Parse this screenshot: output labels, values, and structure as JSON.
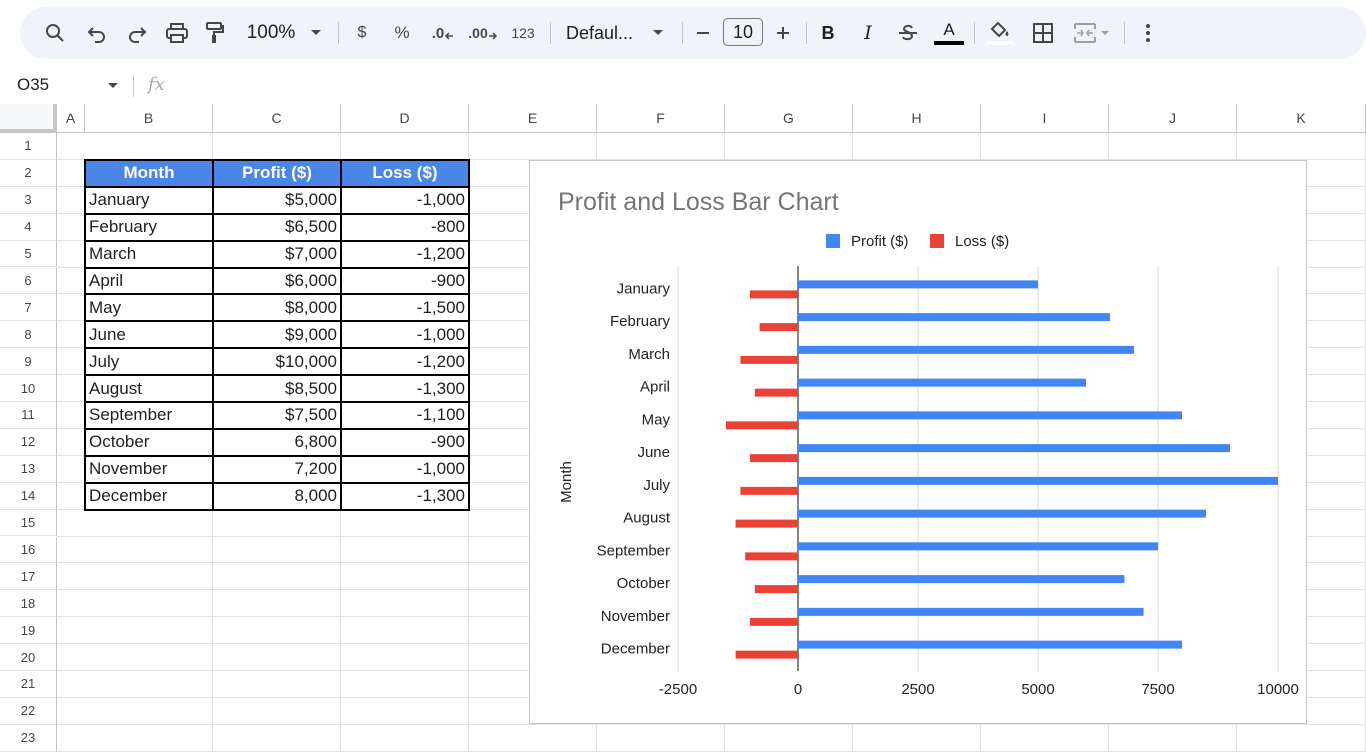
{
  "toolbar": {
    "zoom": "100%",
    "currency_label": "$",
    "percent_label": "%",
    "decrease_decimal_label": ".0",
    "increase_decimal_label": ".00",
    "more_formats_label": "123",
    "font_name": "Defaul...",
    "font_size": "10",
    "bold_label": "B",
    "italic_label": "I",
    "text_color_label": "A",
    "icons": [
      "search-icon",
      "undo-icon",
      "redo-icon",
      "print-icon",
      "paint-format-icon",
      "zoom-dropdown-icon",
      "font-dropdown-icon",
      "minus-icon",
      "plus-icon",
      "strikethrough-icon",
      "fill-color-icon",
      "borders-icon",
      "merge-cells-icon",
      "more-vert-icon"
    ]
  },
  "formula_bar": {
    "name_box": "O35",
    "fx_label": "fx"
  },
  "columns": [
    "A",
    "B",
    "C",
    "D",
    "E",
    "F",
    "G",
    "H",
    "I",
    "J",
    "K"
  ],
  "rows": [
    "1",
    "2",
    "3",
    "4",
    "5",
    "6",
    "7",
    "8",
    "9",
    "10",
    "11",
    "12",
    "13",
    "14",
    "15",
    "16",
    "17",
    "18",
    "19",
    "20",
    "21",
    "22",
    "23"
  ],
  "table": {
    "headers": [
      "Month",
      "Profit ($)",
      "Loss ($)"
    ],
    "header_color": "#4a86e8",
    "rows": [
      [
        "January",
        "$5,000",
        "-1,000"
      ],
      [
        "February",
        "$6,500",
        "-800"
      ],
      [
        "March",
        "$7,000",
        "-1,200"
      ],
      [
        "April",
        "$6,000",
        "-900"
      ],
      [
        "May",
        "$8,000",
        "-1,500"
      ],
      [
        "June",
        "$9,000",
        "-1,000"
      ],
      [
        "July",
        "$10,000",
        "-1,200"
      ],
      [
        "August",
        "$8,500",
        "-1,300"
      ],
      [
        "September",
        "$7,500",
        "-1,100"
      ],
      [
        "October",
        "6,800",
        "-900"
      ],
      [
        "November",
        "7,200",
        "-1,000"
      ],
      [
        "December",
        "8,000",
        "-1,300"
      ]
    ]
  },
  "chart_data": {
    "type": "bar",
    "orientation": "horizontal",
    "title": "Profit and Loss Bar Chart",
    "xlabel": "",
    "ylabel": "Month",
    "categories": [
      "January",
      "February",
      "March",
      "April",
      "May",
      "June",
      "July",
      "August",
      "September",
      "October",
      "November",
      "December"
    ],
    "series": [
      {
        "name": "Profit ($)",
        "color": "#4285f4",
        "values": [
          5000,
          6500,
          7000,
          6000,
          8000,
          9000,
          10000,
          8500,
          7500,
          6800,
          7200,
          8000
        ]
      },
      {
        "name": "Loss ($)",
        "color": "#ea4335",
        "values": [
          -1000,
          -800,
          -1200,
          -900,
          -1500,
          -1000,
          -1200,
          -1300,
          -1100,
          -900,
          -1000,
          -1300
        ]
      }
    ],
    "xlim": [
      -2500,
      10000
    ],
    "xticks": [
      "-2500",
      "0",
      "2500",
      "5000",
      "7500",
      "10000"
    ],
    "grid": true,
    "legend_position": "top"
  }
}
